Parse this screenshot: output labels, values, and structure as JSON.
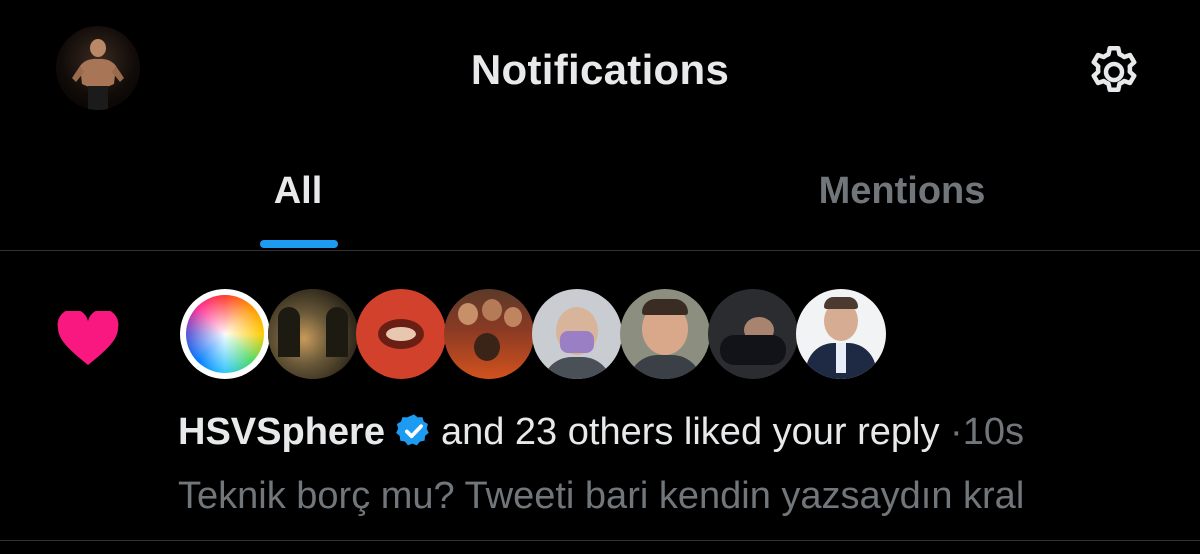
{
  "header": {
    "title": "Notifications",
    "settings_icon": "gear-icon",
    "profile_icon": "avatar"
  },
  "tabs": [
    {
      "label": "All",
      "active": true
    },
    {
      "label": "Mentions",
      "active": false
    }
  ],
  "accent_color": "#1d9bf0",
  "notification": {
    "type_icon": "heart-icon",
    "type_color": "#f91880",
    "avatars_count": 8,
    "user": "HSVSphere",
    "verified": true,
    "action": "and 23 others liked your reply",
    "separator": "·",
    "time": "10s",
    "snippet": "Teknik borç mu? Tweeti bari kendin yazsaydın kral"
  }
}
